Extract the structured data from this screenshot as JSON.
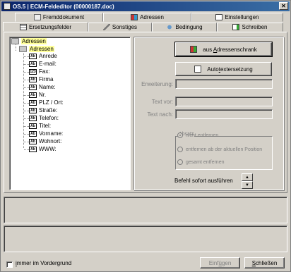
{
  "window": {
    "title": "OS.5 | ECM-Feldeditor (00000187.doc)",
    "close_glyph": "✕"
  },
  "tabs": {
    "row1": [
      {
        "label": "Fremddokument",
        "icon": "document-icon"
      },
      {
        "label": "Adressen",
        "icon": "address-book-icon"
      },
      {
        "label": "Einstellungen",
        "icon": "settings-icon"
      }
    ],
    "row2": [
      {
        "label": "Ersetzungsfelder",
        "icon": "grid-icon"
      },
      {
        "label": "Sonstiges",
        "icon": "wrench-icon"
      },
      {
        "label": "Bedingung",
        "icon": "condition-icon"
      },
      {
        "label": "Schreiben",
        "icon": "write-icon"
      }
    ],
    "active": "Ersetzungsfelder"
  },
  "tree": {
    "root": "Adressen",
    "child": "Adressen",
    "fields": [
      {
        "label": "Anrede",
        "badge": "Ab"
      },
      {
        "label": "E-mail:",
        "badge": "Ab"
      },
      {
        "label": "Fax:",
        "badge": "123"
      },
      {
        "label": "Firma",
        "badge": "Ab"
      },
      {
        "label": "Name:",
        "badge": "Ab"
      },
      {
        "label": "Nr.",
        "badge": "Ab"
      },
      {
        "label": "PLZ / Ort:",
        "badge": "Ab"
      },
      {
        "label": "Straße:",
        "badge": "Ab"
      },
      {
        "label": "Telefon:",
        "badge": "Ab"
      },
      {
        "label": "Titel:",
        "badge": "Ab"
      },
      {
        "label": "Vorname:",
        "badge": "Ab"
      },
      {
        "label": "Wohnort:",
        "badge": "Ab"
      },
      {
        "label": "WWW:",
        "badge": "Ab"
      }
    ]
  },
  "actions": {
    "adressschrank_prefix": "aus ",
    "adressschrank_hotkey": "A",
    "adressschrank_suffix": "dressenschrank",
    "autotext_prefix": "Auto",
    "autotext_hotkey": "t",
    "autotext_suffix": "extersetzung"
  },
  "fields": {
    "erweiterung_label": "Erweiterung:",
    "text_vor_label": "Text vor:",
    "text_nach_label": "Text nach:"
  },
  "absatz": {
    "legend": "Absatz",
    "options": [
      {
        "label": "nicht entfernen",
        "checked": true
      },
      {
        "label": "entfernen ab der aktuellen Position",
        "checked": false
      },
      {
        "label": "gesamt entfernen",
        "checked": false
      }
    ]
  },
  "befehl": {
    "label": "Befehl sofort ausführen"
  },
  "footer": {
    "checkbox_hotkey": "i",
    "checkbox_rest": "mmer im Vordergrund",
    "einfuegen_prefix": "Einf",
    "einfuegen_hotkey": "ü",
    "einfuegen_suffix": "gen",
    "schliessen_prefix": "",
    "schliessen_hotkey": "S",
    "schliessen_suffix": "chließen"
  }
}
